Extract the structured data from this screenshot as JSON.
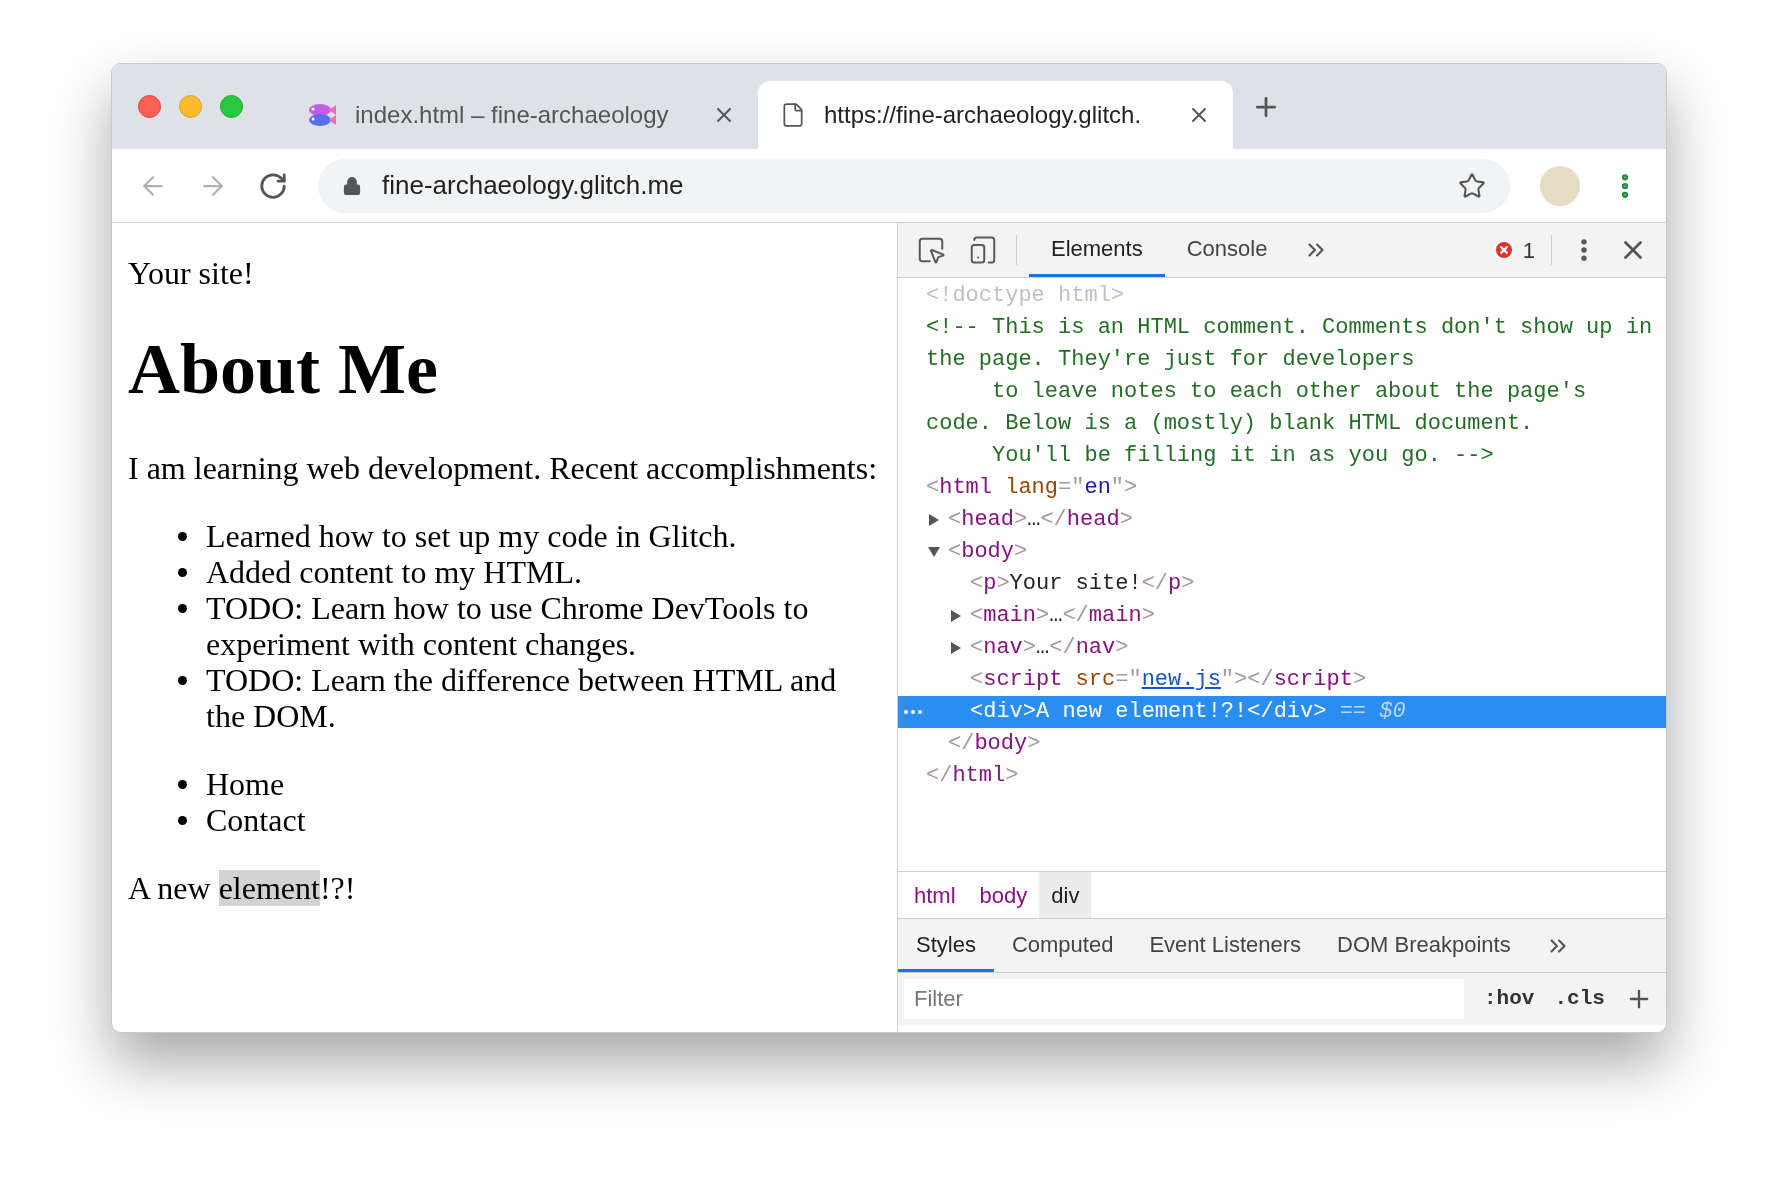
{
  "browser_tabs": [
    {
      "kind": "fish",
      "title": "index.html – fine-archaeology",
      "selected": false
    },
    {
      "kind": "document",
      "title": "https://fine-archaeology.glitch.",
      "selected": true
    }
  ],
  "address": "fine-archaeology.glitch.me",
  "page": {
    "intro": "Your site!",
    "heading": "About Me",
    "paragraph": "I am learning web development. Recent accomplishments:",
    "accomplishments": [
      "Learned how to set up my code in Glitch.",
      "Added content to my HTML.",
      "TODO: Learn how to use Chrome DevTools to experiment with content changes.",
      "TODO: Learn the difference between HTML and the DOM."
    ],
    "nav_links": [
      "Home",
      "Contact"
    ],
    "new_element": {
      "before": "A new ",
      "highlighted": "element",
      "after": "!?!"
    }
  },
  "devtools": {
    "tabs": [
      {
        "label": "Elements",
        "selected": true
      },
      {
        "label": "Console",
        "selected": false
      }
    ],
    "error_count": "1",
    "dom": [
      {
        "kind": "doctype",
        "text": "<!doctype html>",
        "selected": false
      },
      {
        "kind": "comment",
        "text": "<!-- This is an HTML comment. Comments don't show up in the page. They're just for developers\n     to leave notes to each other about the page's code. Below is a (mostly) blank HTML document.\n     You'll be filling it in as you go. -->",
        "selected": false
      },
      {
        "kind": "element",
        "selected": false,
        "tokens": [
          {
            "kind": "punct",
            "text": "<"
          },
          {
            "kind": "tag",
            "text": "html"
          },
          {
            "kind": "attr",
            "text": " lang"
          },
          {
            "kind": "punct",
            "text": "=\""
          },
          {
            "kind": "value",
            "text": "en"
          },
          {
            "kind": "punct",
            "text": "\">"
          }
        ],
        "children": [
          {
            "kind": "element",
            "selected": false,
            "expanded": false,
            "tokens": [
              {
                "kind": "punct",
                "text": "<"
              },
              {
                "kind": "tag",
                "text": "head"
              },
              {
                "kind": "punct",
                "text": ">"
              },
              {
                "kind": "text",
                "text": "…"
              },
              {
                "kind": "punct",
                "text": "</"
              },
              {
                "kind": "tag",
                "text": "head"
              },
              {
                "kind": "punct",
                "text": ">"
              }
            ]
          },
          {
            "kind": "element",
            "selected": false,
            "expanded": true,
            "tokens": [
              {
                "kind": "punct",
                "text": "<"
              },
              {
                "kind": "tag",
                "text": "body"
              },
              {
                "kind": "punct",
                "text": ">"
              }
            ],
            "children": [
              {
                "kind": "element",
                "selected": false,
                "tokens": [
                  {
                    "kind": "punct",
                    "text": "<"
                  },
                  {
                    "kind": "tag",
                    "text": "p"
                  },
                  {
                    "kind": "punct",
                    "text": ">"
                  },
                  {
                    "kind": "text",
                    "text": "Your site!"
                  },
                  {
                    "kind": "punct",
                    "text": "</"
                  },
                  {
                    "kind": "tag",
                    "text": "p"
                  },
                  {
                    "kind": "punct",
                    "text": ">"
                  }
                ]
              },
              {
                "kind": "element",
                "selected": false,
                "expanded": false,
                "tokens": [
                  {
                    "kind": "punct",
                    "text": "<"
                  },
                  {
                    "kind": "tag",
                    "text": "main"
                  },
                  {
                    "kind": "punct",
                    "text": ">"
                  },
                  {
                    "kind": "text",
                    "text": "…"
                  },
                  {
                    "kind": "punct",
                    "text": "</"
                  },
                  {
                    "kind": "tag",
                    "text": "main"
                  },
                  {
                    "kind": "punct",
                    "text": ">"
                  }
                ]
              },
              {
                "kind": "element",
                "selected": false,
                "expanded": false,
                "tokens": [
                  {
                    "kind": "punct",
                    "text": "<"
                  },
                  {
                    "kind": "tag",
                    "text": "nav"
                  },
                  {
                    "kind": "punct",
                    "text": ">"
                  },
                  {
                    "kind": "text",
                    "text": "…"
                  },
                  {
                    "kind": "punct",
                    "text": "</"
                  },
                  {
                    "kind": "tag",
                    "text": "nav"
                  },
                  {
                    "kind": "punct",
                    "text": ">"
                  }
                ]
              },
              {
                "kind": "element",
                "selected": false,
                "tokens": [
                  {
                    "kind": "punct",
                    "text": "<"
                  },
                  {
                    "kind": "tag",
                    "text": "script"
                  },
                  {
                    "kind": "attr",
                    "text": " src"
                  },
                  {
                    "kind": "punct",
                    "text": "=\""
                  },
                  {
                    "kind": "link",
                    "text": "new.js"
                  },
                  {
                    "kind": "punct",
                    "text": "\">"
                  },
                  {
                    "kind": "punct",
                    "text": "</"
                  },
                  {
                    "kind": "tag",
                    "text": "script"
                  },
                  {
                    "kind": "punct",
                    "text": ">"
                  }
                ]
              },
              {
                "kind": "element",
                "selected": true,
                "tokens": [
                  {
                    "kind": "punct",
                    "text": "<"
                  },
                  {
                    "kind": "tag",
                    "text": "div"
                  },
                  {
                    "kind": "punct",
                    "text": ">"
                  },
                  {
                    "kind": "text",
                    "text": "A new element!?!"
                  },
                  {
                    "kind": "punct",
                    "text": "</"
                  },
                  {
                    "kind": "tag",
                    "text": "div"
                  },
                  {
                    "kind": "punct",
                    "text": ">"
                  },
                  {
                    "kind": "marker",
                    "text": " == $0"
                  }
                ]
              }
            ],
            "closing": [
              {
                "kind": "punct",
                "text": "</"
              },
              {
                "kind": "tag",
                "text": "body"
              },
              {
                "kind": "punct",
                "text": ">"
              }
            ]
          }
        ],
        "closing": [
          {
            "kind": "punct",
            "text": "</"
          },
          {
            "kind": "tag",
            "text": "html"
          },
          {
            "kind": "punct",
            "text": ">"
          }
        ]
      }
    ],
    "breadcrumbs": [
      {
        "label": "html",
        "selected": false
      },
      {
        "label": "body",
        "selected": false
      },
      {
        "label": "div",
        "selected": true
      }
    ],
    "sub_tabs": [
      {
        "label": "Styles",
        "selected": true
      },
      {
        "label": "Computed",
        "selected": false
      },
      {
        "label": "Event Listeners",
        "selected": false
      },
      {
        "label": "DOM Breakpoints",
        "selected": false
      }
    ],
    "filter": {
      "placeholder": "Filter"
    },
    "style_buttons": [
      ":hov",
      ".cls"
    ]
  }
}
